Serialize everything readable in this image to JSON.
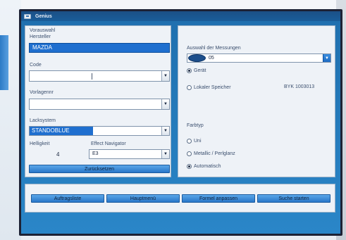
{
  "window": {
    "title": "Genius"
  },
  "left": {
    "vorauswahl_label": "Vorauswahl",
    "hersteller_label": "Hersteller",
    "hersteller_value": "MAZDA",
    "code_label": "Code",
    "code_value": "",
    "vorlagennr_label": "Vorlagennr",
    "vorlagennr_value": "",
    "lacksystem_label": "Lacksystem",
    "lacksystem_value": "STANDOBLUE",
    "helligkeit_label": "Helligkeit",
    "helligkeit_value": "4",
    "effect_label": "Effect Navigator",
    "effect_value": "E3",
    "zuruecksetzen_label": "Zurücksetzen"
  },
  "right": {
    "auswahl_label": "Auswahl der Messungen",
    "messung_value": "05",
    "geraet_label": "Gerät",
    "lokaler_label": "Lokaler Speicher",
    "serial": "BYK 1003013",
    "farbtyp_label": "Farbtyp",
    "uni_label": "Uni",
    "metallic_label": "Metallic / Perlglanz",
    "automatisch_label": "Automatisch"
  },
  "bottom": {
    "auftragsliste": "Auftragsliste",
    "hauptmenu": "Hauptmenü",
    "formel_anpassen": "Formel anpassen",
    "suche_starten": "Suche starten"
  },
  "icons": {
    "dropdown": "chevron-down-icon",
    "cursor": "text-cursor-icon",
    "window": "app-window-icon"
  },
  "colors": {
    "title_bar": "#1b4f86",
    "window_bg": "#2a86c8",
    "panel_bg": "#eef2f7",
    "selected_field": "#1f6fcf",
    "button": "#3a8ee0"
  }
}
